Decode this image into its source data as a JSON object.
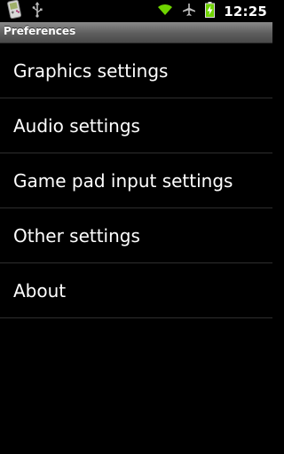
{
  "status_bar": {
    "icons_left": [
      "gameboy-app-icon",
      "usb-icon"
    ],
    "icons_right": [
      "wifi-icon",
      "airplane-mode-icon",
      "battery-charging-icon"
    ],
    "time": "12:25",
    "colors": {
      "wifi": "#6fd400",
      "battery": "#6fd400"
    }
  },
  "title_bar": {
    "title": "Preferences"
  },
  "menu": {
    "items": [
      {
        "label": "Graphics settings"
      },
      {
        "label": "Audio settings"
      },
      {
        "label": "Game pad input settings"
      },
      {
        "label": "Other settings"
      },
      {
        "label": "About"
      }
    ]
  }
}
